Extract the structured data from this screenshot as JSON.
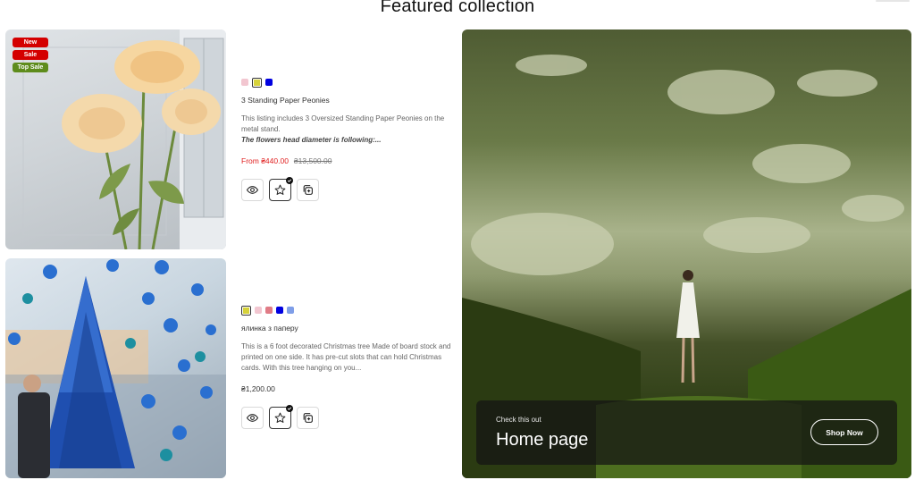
{
  "section": {
    "title": "Featured collection"
  },
  "products": [
    {
      "badges": [
        "New",
        "Sale",
        "Top Sale"
      ],
      "swatches": [
        "#f2c6d0",
        "#d6d23a",
        "#0000e0"
      ],
      "active_swatch": 1,
      "name": "3 Standing Paper Peonies",
      "desc_line1": "This listing includes 3 Oversized Standing Paper Peonies on the metal stand.",
      "desc_bold": "The flowers head diameter is following:...",
      "price": "From ₴440.00",
      "old_price": "₴13,500.00"
    },
    {
      "swatches": [
        "#d6d23a",
        "#f2c6d0",
        "#e07b86",
        "#0000e0",
        "#7f9ee8"
      ],
      "active_swatch": 0,
      "name": "ялинка з паперу",
      "desc_line1": "This is a 6 foot decorated Christmas tree Made of board stock and printed on one side. It has pre-cut slots that can hold Christmas cards. With this tree hanging on you...",
      "price": "₴1,200.00"
    }
  ],
  "hero": {
    "subtitle": "Check this out",
    "title": "Home page",
    "button_label": "Shop Now"
  },
  "icons": {
    "view": "eye-icon",
    "wishlist": "star-icon",
    "compare": "compare-icon",
    "check": "check-icon"
  }
}
